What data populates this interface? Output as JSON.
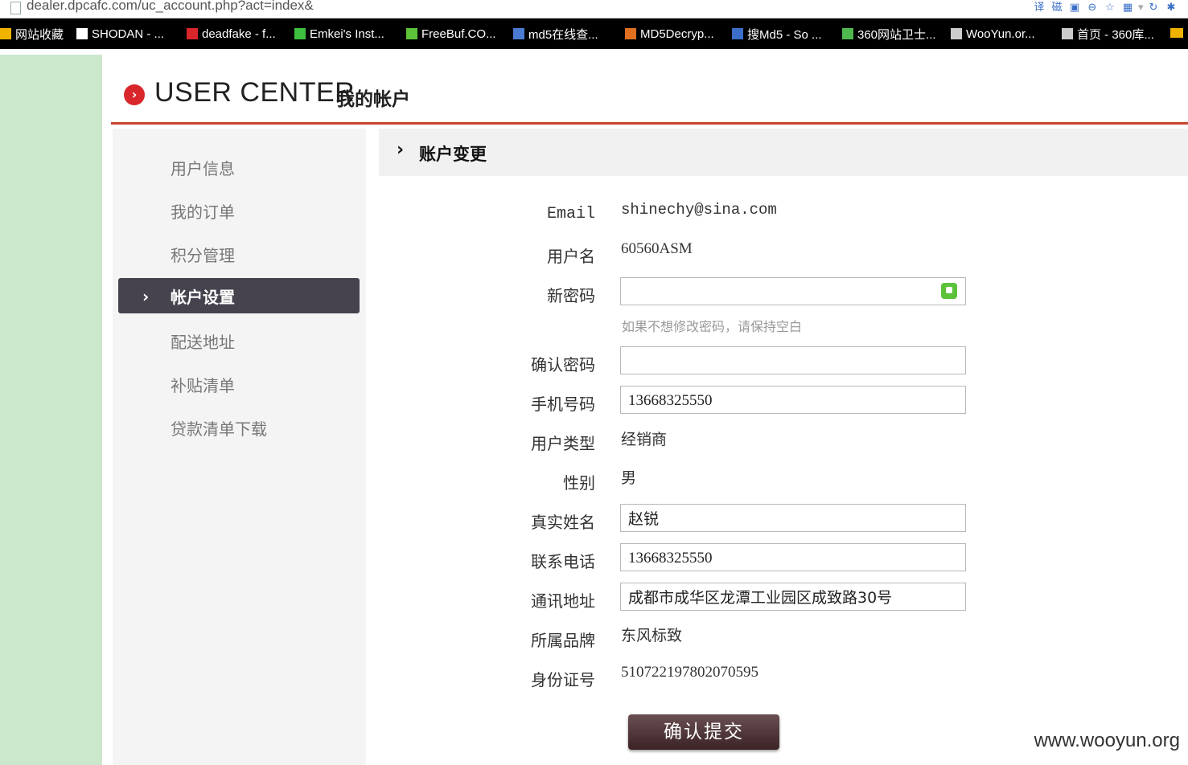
{
  "browser": {
    "url": "dealer.dpcafc.com/uc_account.php?act=index&",
    "bookmarks": [
      {
        "label": "网站收藏",
        "icon": "folder-icon",
        "color": "#f0b400"
      },
      {
        "label": "SHODAN - ...",
        "icon": "page-icon",
        "color": "#ffffff"
      },
      {
        "label": "deadfake - f...",
        "icon": "bars-icon",
        "color": "#d9262b"
      },
      {
        "label": "Emkei's Inst...",
        "icon": "green-flag-icon",
        "color": "#3fbf3f"
      },
      {
        "label": "FreeBuf.CO...",
        "icon": "freebuf-icon",
        "color": "#5cc23a"
      },
      {
        "label": "md5在线查...",
        "icon": "grid-icon",
        "color": "#4a7bd0"
      },
      {
        "label": "MD5Decryp...",
        "icon": "flame-icon",
        "color": "#e07020"
      },
      {
        "label": "搜Md5 - So ...",
        "icon": "md5-icon",
        "color": "#3a6ec8"
      },
      {
        "label": "360网站卫士...",
        "icon": "shield-icon",
        "color": "#4fb84f"
      },
      {
        "label": "WooYun.or...",
        "icon": "cloud-icon",
        "color": "#cccccc"
      },
      {
        "label": "首页 - 360库...",
        "icon": "star-icon",
        "color": "#cccccc"
      }
    ]
  },
  "header": {
    "title": "USER CENTER",
    "subtitle": "我的帐户"
  },
  "sidebar": {
    "items": [
      {
        "label": "用户信息",
        "active": false
      },
      {
        "label": "我的订单",
        "active": false
      },
      {
        "label": "积分管理",
        "active": false
      },
      {
        "label": "帐户设置",
        "active": true
      },
      {
        "label": "配送地址",
        "active": false
      },
      {
        "label": "补贴清单",
        "active": false
      },
      {
        "label": "贷款清单下载",
        "active": false
      }
    ]
  },
  "section": {
    "title": "账户变更"
  },
  "form": {
    "email_label": "Email",
    "email_value": "shinechy@sina.com",
    "username_label": "用户名",
    "username_value": "60560ASM",
    "new_password_label": "新密码",
    "new_password_value": "",
    "password_hint": "如果不想修改密码，请保持空白",
    "confirm_password_label": "确认密码",
    "confirm_password_value": "",
    "mobile_label": "手机号码",
    "mobile_value": "13668325550",
    "user_type_label": "用户类型",
    "user_type_value": "经销商",
    "gender_label": "性别",
    "gender_value": "男",
    "real_name_label": "真实姓名",
    "real_name_value": "赵锐",
    "phone_label": "联系电话",
    "phone_value": "13668325550",
    "address_label": "通讯地址",
    "address_value": "成都市成华区龙潭工业园区成致路30号",
    "brand_label": "所属品牌",
    "brand_value": "东风标致",
    "id_label": "身份证号",
    "id_value": "510722197802070595",
    "submit_label": "确认提交"
  },
  "watermark": "www.wooyun.org"
}
